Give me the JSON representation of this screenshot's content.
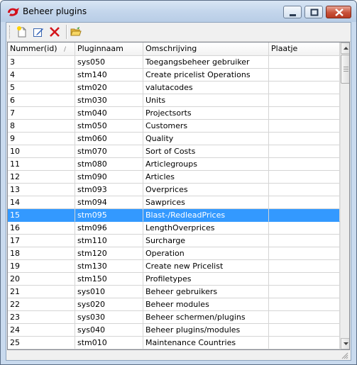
{
  "window": {
    "title": "Beheer plugins"
  },
  "toolbar": {
    "buttons": [
      {
        "name": "new-icon"
      },
      {
        "name": "edit-icon"
      },
      {
        "name": "delete-icon"
      },
      {
        "name": "open-folder-icon"
      }
    ]
  },
  "grid": {
    "columns": [
      "Nummer(id)",
      "Pluginnaam",
      "Omschrijving",
      "Plaatje"
    ],
    "sort_indicator": "/",
    "selected_id": "15",
    "rows": [
      {
        "id": "3",
        "plugin": "sys050",
        "desc": "Toegangsbeheer gebruiker",
        "img": ""
      },
      {
        "id": "4",
        "plugin": "stm140",
        "desc": "Create pricelist Operations",
        "img": ""
      },
      {
        "id": "5",
        "plugin": "stm020",
        "desc": "valutacodes",
        "img": ""
      },
      {
        "id": "6",
        "plugin": "stm030",
        "desc": "Units",
        "img": ""
      },
      {
        "id": "7",
        "plugin": "stm040",
        "desc": "Projectsorts",
        "img": ""
      },
      {
        "id": "8",
        "plugin": "stm050",
        "desc": "Customers",
        "img": ""
      },
      {
        "id": "9",
        "plugin": "stm060",
        "desc": "Quality",
        "img": ""
      },
      {
        "id": "10",
        "plugin": "stm070",
        "desc": "Sort of Costs",
        "img": ""
      },
      {
        "id": "11",
        "plugin": "stm080",
        "desc": "Articlegroups",
        "img": ""
      },
      {
        "id": "12",
        "plugin": "stm090",
        "desc": "Articles",
        "img": ""
      },
      {
        "id": "13",
        "plugin": "stm093",
        "desc": "Overprices",
        "img": ""
      },
      {
        "id": "14",
        "plugin": "stm094",
        "desc": "Sawprices",
        "img": ""
      },
      {
        "id": "15",
        "plugin": "stm095",
        "desc": "Blast-/RedleadPrices",
        "img": ""
      },
      {
        "id": "16",
        "plugin": "stm096",
        "desc": "LengthOverprices",
        "img": ""
      },
      {
        "id": "17",
        "plugin": "stm110",
        "desc": "Surcharge",
        "img": ""
      },
      {
        "id": "18",
        "plugin": "stm120",
        "desc": "Operation",
        "img": ""
      },
      {
        "id": "19",
        "plugin": "stm130",
        "desc": "Create new Pricelist",
        "img": ""
      },
      {
        "id": "20",
        "plugin": "stm150",
        "desc": "Profiletypes",
        "img": ""
      },
      {
        "id": "21",
        "plugin": "sys010",
        "desc": "Beheer gebruikers",
        "img": ""
      },
      {
        "id": "22",
        "plugin": "sys020",
        "desc": "Beheer modules",
        "img": ""
      },
      {
        "id": "23",
        "plugin": "sys030",
        "desc": "Beheer schermen/plugins",
        "img": ""
      },
      {
        "id": "24",
        "plugin": "sys040",
        "desc": "Beheer plugins/modules",
        "img": ""
      },
      {
        "id": "25",
        "plugin": "stm010",
        "desc": "Maintenance Countries",
        "img": ""
      }
    ]
  },
  "colors": {
    "selection": "#3399ff",
    "title_accent": "#c8101e"
  }
}
